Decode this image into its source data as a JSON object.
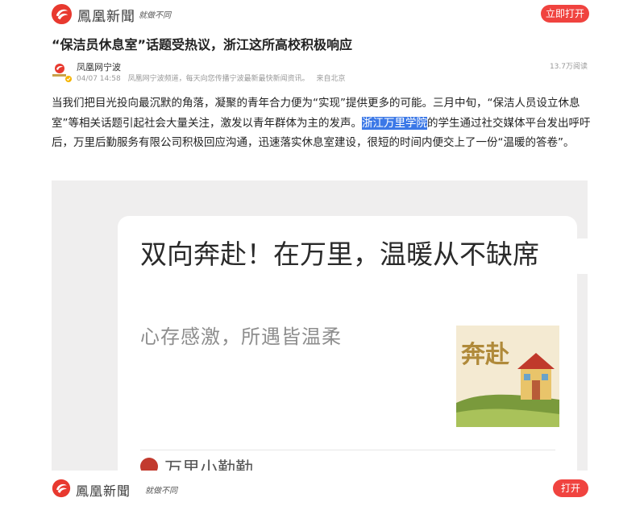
{
  "header": {
    "logo_text": "鳳凰新聞",
    "slogan": "就做不同",
    "open_button": "立即打开"
  },
  "article": {
    "title": "“保洁员休息室”话题受热议，浙江这所高校积极响应",
    "author": "凤凰网宁波",
    "date": "04/07 14:58",
    "author_desc": "凤凰网宁波频道，每天向您传播宁波最新最快新闻资讯。",
    "source": "来自北京",
    "views": "13.7万阅读",
    "body_before": "当我们把目光投向最沉默的角落，凝聚的青年合力便为“实现”提供更多的可能。三月中旬，“保洁人员设立休息室”等相关话题引起社会大量关注，激发以青年群体为主的发声。",
    "body_highlight": "浙江万里学院",
    "body_after": "的学生通过社交媒体平台发出呼吁后，万里后勤服务有限公司积极回应沟通，迅速落实休息室建设，很短的时间内便交上了一份“温暖的答卷”。"
  },
  "embed": {
    "card_title": "双向奔赴！在万里，温暖从不缺席",
    "card_subtitle": "心存感激，所遇皆温柔",
    "thumb_text": "奔赴",
    "account_name": "万里小勤勤"
  },
  "footer": {
    "logo_text": "鳳凰新聞",
    "slogan": "就做不同",
    "open_button": "打开"
  },
  "colors": {
    "accent": "#f0433f",
    "highlight": "#3b78e7"
  }
}
